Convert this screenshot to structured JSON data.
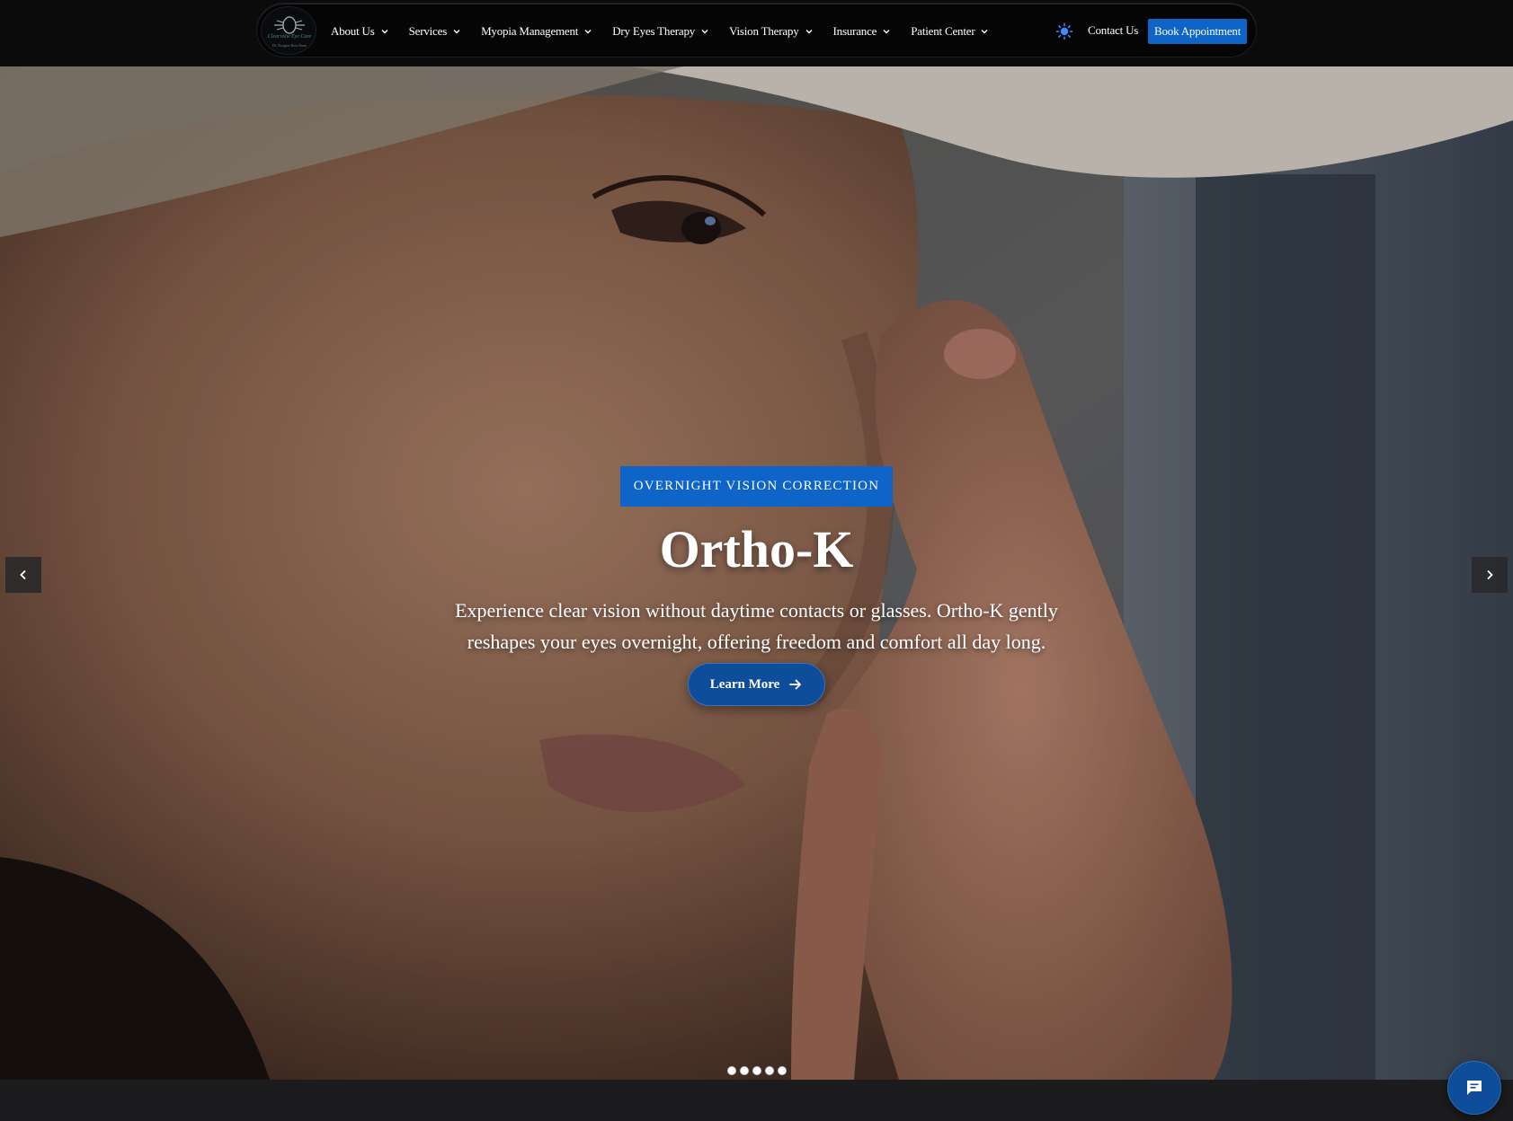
{
  "header": {
    "logo": {
      "name": "Clearview Eye Care",
      "tagline": "Dr. Douglas Ross Bunn"
    },
    "nav": [
      {
        "label": "About Us",
        "has_dropdown": true
      },
      {
        "label": "Services",
        "has_dropdown": true
      },
      {
        "label": "Myopia Management",
        "has_dropdown": true
      },
      {
        "label": "Dry Eyes Therapy",
        "has_dropdown": true
      },
      {
        "label": "Vision Therapy",
        "has_dropdown": true
      },
      {
        "label": "Insurance",
        "has_dropdown": true
      },
      {
        "label": "Patient Center",
        "has_dropdown": true
      }
    ],
    "theme_icon": "sun-icon",
    "contact_label": "Contact Us",
    "book_label": "Book Appointment"
  },
  "hero": {
    "tag": "OVERNIGHT VISION CORRECTION",
    "title": "Ortho-K",
    "description": "Experience clear vision without daytime contacts or glasses. Ortho-K gently reshapes your eyes overnight, offering freedom and comfort all day long.",
    "cta_label": "Learn More",
    "cta_icon": "arrow-right-icon",
    "prev_icon": "chevron-left-icon",
    "next_icon": "chevron-right-icon",
    "slide_count": 5
  },
  "chat": {
    "icon": "chat-bubble-icon"
  },
  "colors": {
    "brand_blue": "#0f64c8",
    "cta_blue": "#0e4d9a",
    "topbar": "#0b0b0c",
    "background": "#1c1c1e",
    "theme_icon": "#3d8cff"
  }
}
